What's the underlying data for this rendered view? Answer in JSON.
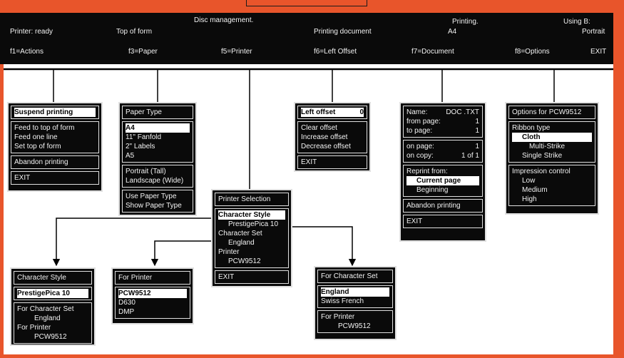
{
  "colors": {
    "accent": "#e8552b",
    "panel": "#0a0a0a",
    "text": "#f2f2f2"
  },
  "status_bar": {
    "disc_management": "Disc management.",
    "printing": "Printing.",
    "using": "Using B:",
    "printer_ready": "Printer: ready",
    "top_of_form": "Top of form",
    "printing_document": "Printing document",
    "paper_size": "A4",
    "orientation": "Portrait"
  },
  "function_keys": {
    "f1": "f1=Actions",
    "f3": "f3=Paper",
    "f5": "f5=Printer",
    "f6": "f6=Left Offset",
    "f7": "f7=Document",
    "f8": "f8=Options",
    "exit": "EXIT"
  },
  "actions_menu": {
    "title": "Suspend printing",
    "items": [
      "Feed to top of form",
      "Feed one line",
      "Set top of form"
    ],
    "abandon": "Abandon printing",
    "exit": "EXIT"
  },
  "paper_menu": {
    "title": "Paper Type",
    "sizes": [
      "A4",
      "11\" Fanfold",
      "2\" Labels",
      "A5"
    ],
    "orientations": [
      "Portrait (Tall)",
      "Landscape (Wide)"
    ],
    "use_type": "Use Paper Type",
    "show_type": "Show Paper Type"
  },
  "offset_menu": {
    "title": "Left offset",
    "value": "0",
    "items": [
      "Clear offset",
      "Increase offset",
      "Decrease offset"
    ],
    "exit": "EXIT"
  },
  "document_menu": {
    "name_label": "Name:",
    "name_value": "DOC .TXT",
    "from_page_label": "from page:",
    "from_page_value": "1",
    "to_page_label": "to page:",
    "to_page_value": "1",
    "on_page_label": "on page:",
    "on_page_value": "1",
    "on_copy_label": "on copy:",
    "on_copy_value": "1 of 1",
    "reprint_from": "Reprint from:",
    "current_page": "Current page",
    "beginning": "Beginning",
    "abandon": "Abandon printing",
    "exit": "EXIT"
  },
  "options_menu": {
    "title": "Options for PCW9512",
    "ribbon_type": "Ribbon type",
    "ribbons": [
      "Cloth",
      "Multi-Strike",
      "Single Strike"
    ],
    "impression": "Impression control",
    "levels": [
      "Low",
      "Medium",
      "High"
    ]
  },
  "printer_selection": {
    "title": "Printer Selection",
    "char_style_label": "Character Style",
    "char_style_value": "PrestigePica 10",
    "char_set_label": "Character Set",
    "char_set_value": "England",
    "printer_label": "Printer",
    "printer_value": "PCW9512",
    "exit": "EXIT"
  },
  "char_style_box": {
    "title": "Character Style",
    "selected": "PrestigePica 10",
    "for_set_label": "For Character Set",
    "for_set_value": "England",
    "for_printer_label": "For Printer",
    "for_printer_value": "PCW9512"
  },
  "for_printer_box": {
    "title": "For Printer",
    "items": [
      "PCW9512",
      "D630",
      "DMP"
    ]
  },
  "char_set_box": {
    "title": "For Character Set",
    "items": [
      "England",
      "Swiss French"
    ],
    "for_printer_label": "For Printer",
    "for_printer_value": "PCW9512"
  }
}
